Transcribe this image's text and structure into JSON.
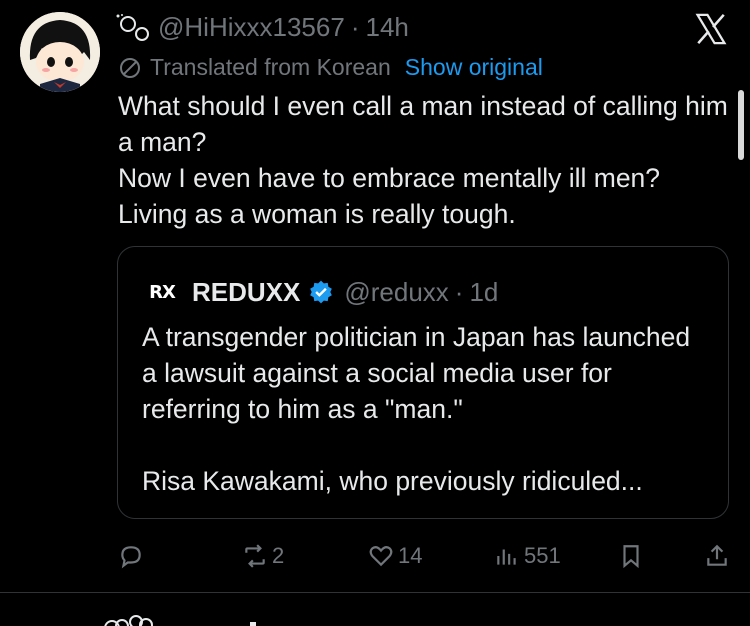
{
  "tweet": {
    "handle": "@HiHixxx13567",
    "separator": "·",
    "time": "14h",
    "translated_label": "Translated from Korean",
    "show_original": "Show original",
    "text_lines": [
      "What should I even call a man instead of calling him a man?",
      "Now I even have to embrace mentally ill men?",
      "Living as a woman is really tough."
    ]
  },
  "quote": {
    "logo_text": "RX",
    "name": "REDUXX",
    "handle": "@reduxx",
    "separator": "·",
    "time": "1d",
    "paragraphs": [
      "A transgender politician in Japan has launched a lawsuit against a social media user for referring to him as a \"man.\"",
      "Risa Kawakami, who previously ridiculed..."
    ]
  },
  "actions": {
    "replies": "",
    "reposts": "2",
    "likes": "14",
    "views": "551"
  },
  "colors": {
    "background": "#000000",
    "text": "#e7e9ea",
    "muted": "#71767b",
    "link": "#1d9bf0",
    "border": "#2f3336"
  },
  "icons": [
    "x-logo-icon",
    "translate-icon",
    "verified-badge-icon",
    "reply-icon",
    "repost-icon",
    "like-icon",
    "views-icon",
    "bookmark-icon",
    "share-icon"
  ]
}
